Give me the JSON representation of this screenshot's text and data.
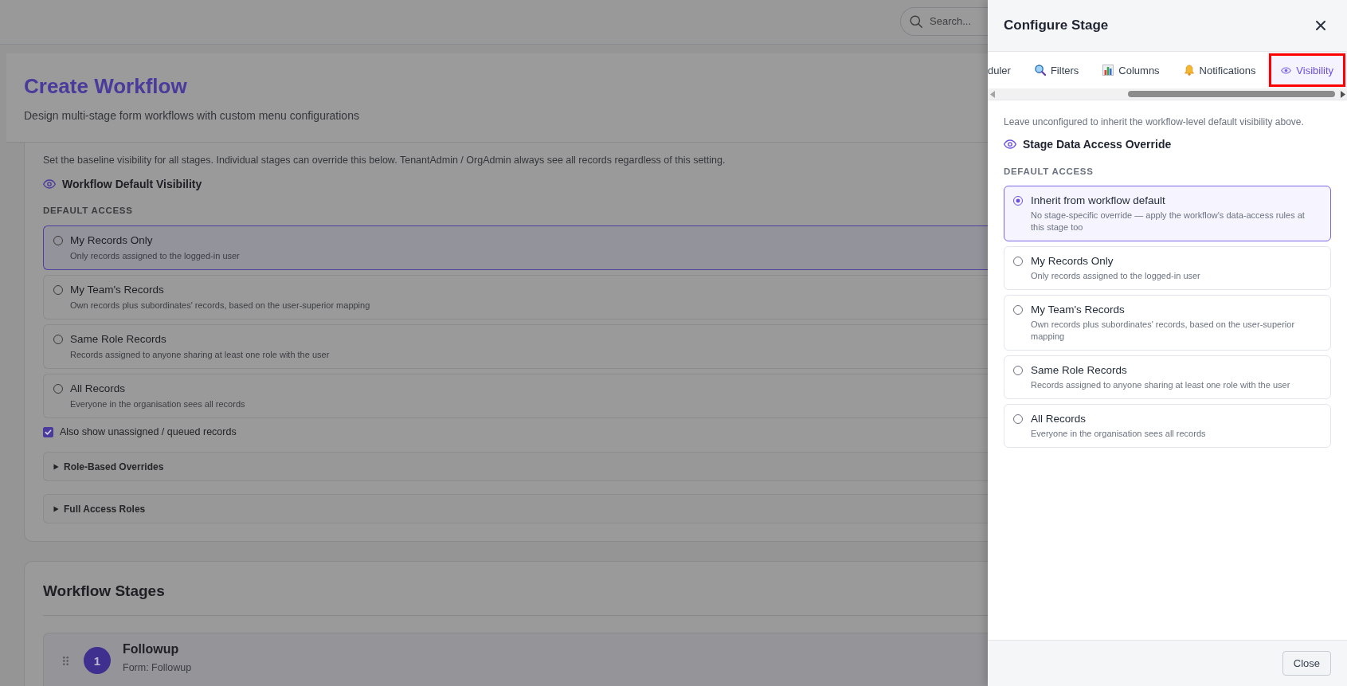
{
  "top_bar": {
    "search": {
      "placeholder": "Search..."
    }
  },
  "page_header": {
    "title": "Create Workflow",
    "subtitle": "Design multi-stage form workflows with custom menu configurations"
  },
  "visibility_card": {
    "description": "Set the baseline visibility for all stages. Individual stages can override this below. TenantAdmin / OrgAdmin always see all records regardless of this setting.",
    "heading": "Workflow Default Visibility",
    "section_label": "DEFAULT ACCESS",
    "options": [
      {
        "title": "My Records Only",
        "description": "Only records assigned to the logged-in user",
        "selected": false,
        "focused": true
      },
      {
        "title": "My Team's Records",
        "description": "Own records plus subordinates' records, based on the user-superior mapping",
        "selected": false,
        "focused": false
      },
      {
        "title": "Same Role Records",
        "description": "Records assigned to anyone sharing at least one role with the user",
        "selected": false,
        "focused": false
      },
      {
        "title": "All Records",
        "description": "Everyone in the organisation sees all records",
        "selected": false,
        "focused": false
      }
    ],
    "unassigned_checkbox": {
      "label": "Also show unassigned / queued records",
      "checked": true
    },
    "sections": [
      {
        "title": "Role-Based Overrides",
        "expanded": false
      },
      {
        "title": "Full Access Roles",
        "expanded": false
      }
    ]
  },
  "stages_card": {
    "title": "Workflow Stages",
    "stages": [
      {
        "number": "1",
        "name": "Followup",
        "form": "Form: Followup"
      }
    ]
  },
  "drawer": {
    "title": "Configure Stage",
    "tabs": [
      {
        "label": "duler",
        "selected": false,
        "highlighted": false
      },
      {
        "label": "Filters",
        "selected": false,
        "highlighted": false
      },
      {
        "label": "Columns",
        "selected": false,
        "highlighted": false
      },
      {
        "label": "Notifications",
        "selected": false,
        "highlighted": false
      },
      {
        "label": "Visibility",
        "selected": true,
        "highlighted": true
      }
    ],
    "hint": "Leave unconfigured to inherit the workflow-level default visibility above.",
    "heading": "Stage Data Access Override",
    "section_label": "DEFAULT ACCESS",
    "options": [
      {
        "title": "Inherit from workflow default",
        "description": "No stage-specific override — apply the workflow's data-access rules at this stage too",
        "selected": true
      },
      {
        "title": "My Records Only",
        "description": "Only records assigned to the logged-in user",
        "selected": false
      },
      {
        "title": "My Team's Records",
        "description": "Own records plus subordinates' records, based on the user-superior mapping",
        "selected": false
      },
      {
        "title": "Same Role Records",
        "description": "Records assigned to anyone sharing at least one role with the user",
        "selected": false
      },
      {
        "title": "All Records",
        "description": "Everyone in the organisation sees all records",
        "selected": false
      }
    ],
    "close_button": "Close"
  }
}
